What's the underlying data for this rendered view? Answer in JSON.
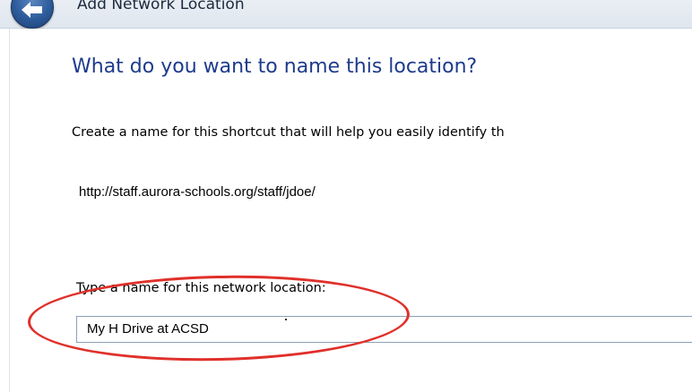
{
  "window": {
    "title": "Add Network Location",
    "back_icon": "back-arrow-icon"
  },
  "wizard": {
    "heading": "What do you want to name this location?",
    "description": "Create a name for this shortcut that will help you easily identify th",
    "location_url": "http://staff.aurora-schools.org/staff/jdoe/",
    "name_field_label": "Type a name for this network location:",
    "name_field_value": "My H Drive at ACSD"
  },
  "annotation": {
    "highlight_color": "#e0302a"
  }
}
